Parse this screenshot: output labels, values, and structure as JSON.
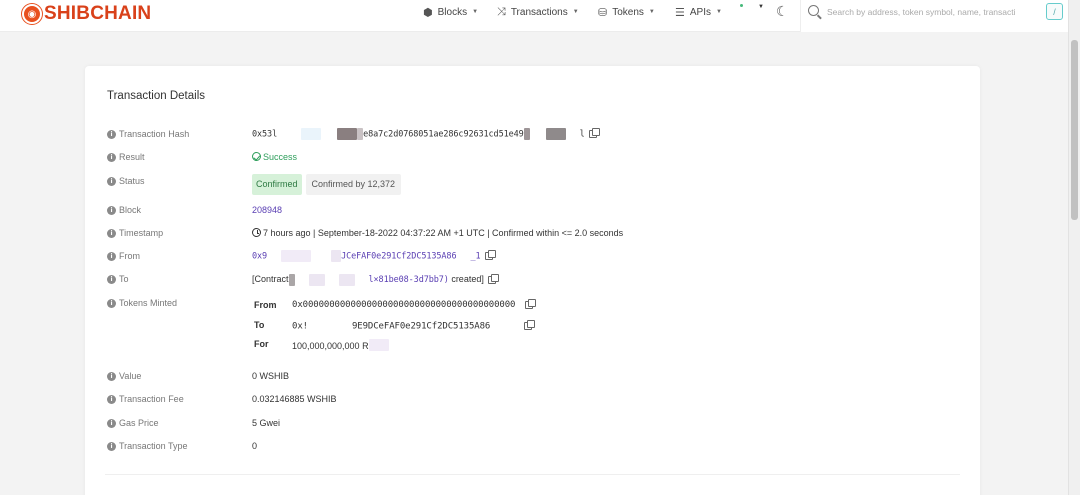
{
  "header": {
    "logo_text": "SHIBCHAIN",
    "nav": [
      {
        "label": "Blocks",
        "icon": "cube-icon"
      },
      {
        "label": "Transactions",
        "icon": "arrows-icon"
      },
      {
        "label": "Tokens",
        "icon": "coins-icon"
      },
      {
        "label": "APIs",
        "icon": "list-icon"
      }
    ],
    "search_placeholder": "Search by address, token symbol, name, transacti",
    "search_key_hint": "/"
  },
  "details": {
    "title": "Transaction Details",
    "labels": {
      "hash": "Transaction Hash",
      "result": "Result",
      "status": "Status",
      "block": "Block",
      "timestamp": "Timestamp",
      "from": "From",
      "to": "To",
      "tokens_minted": "Tokens Minted",
      "value": "Value",
      "fee": "Transaction Fee",
      "gas_price": "Gas Price",
      "tx_type": "Transaction Type"
    },
    "hash_prefix": "0x53l",
    "hash_middle": "e8a7c2d0768051ae286c92631cd51e49",
    "hash_suffix": "l",
    "result": "Success",
    "status_badge": "Confirmed",
    "status_confirmations": "Confirmed by 12,372",
    "block": "208948",
    "timestamp": "7 hours ago | September-18-2022 04:37:22 AM +1 UTC | Confirmed within <= 2.0 seconds",
    "from_prefix": "0x9",
    "from_suffix": "JCeFAF0e291Cf2DC5135A86",
    "from_tail": "_1",
    "to_prefix": "[Contract",
    "to_suffix": "l×81be08-3d7bb7)",
    "to_created": "created]",
    "tokens": {
      "from_label": "From",
      "from_value": "0x0000000000000000000000000000000000000000",
      "to_label": "To",
      "to_prefix": "0x!",
      "to_suffix": "9E9DCeFAF0e291Cf2DC5135A86",
      "for_label": "For",
      "for_value": "100,000,000,000 R"
    },
    "value": "0 WSHIB",
    "fee": "0.032146885 WSHIB",
    "gas_price": "5 Gwei",
    "tx_type": "0"
  }
}
